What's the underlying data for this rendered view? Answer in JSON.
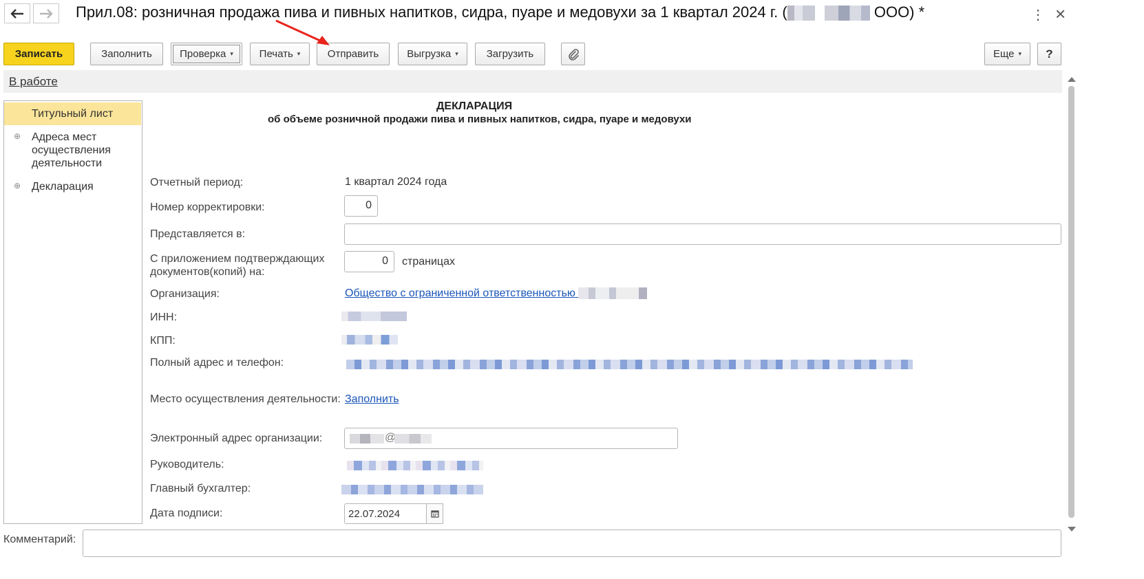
{
  "titlebar": {
    "back_icon": "arrow-left-icon",
    "forward_icon": "arrow-right-icon",
    "title_prefix": "Прил.08: розничная продажа пива и пивных напитков, сидра, пуаре и медовухи за 1 квартал 2024 г. (",
    "title_suffix": " ООО) *",
    "more_icon": "more-vertical-icon",
    "close_icon": "close-icon",
    "more_glyph": "⋮",
    "close_glyph": "×"
  },
  "toolbar": {
    "save": "Записать",
    "fill": "Заполнить",
    "check": "Проверка",
    "print": "Печать",
    "send": "Отправить",
    "export": "Выгрузка",
    "load": "Загрузить",
    "attach_icon": "paperclip-icon",
    "more": "Еще",
    "help": "?",
    "dropdown_glyph": "▾"
  },
  "status": {
    "label": "В работе"
  },
  "sidebar": {
    "items": [
      {
        "label": "Титульный лист",
        "selected": true
      },
      {
        "label": "Адреса мест осуществления деятельности",
        "expandable": true
      },
      {
        "label": "Декларация",
        "expandable": true
      }
    ],
    "expand_glyph": "⊕"
  },
  "form": {
    "heading": "ДЕКЛАРАЦИЯ",
    "subheading": "об объеме розничной продажи пива и пивных напитков, сидра, пуаре и медовухи",
    "period_label": "Отчетный период:",
    "period_value": "1 квартал 2024 года",
    "correction_label": "Номер корректировки:",
    "correction_value": "0",
    "submitted_to_label": "Представляется в:",
    "submitted_to_value": "",
    "attachments_label": "С приложением подтверждающих документов(копий) на:",
    "attachments_value": "0",
    "attachments_unit": "страницах",
    "org_label": "Организация:",
    "org_value": "Общество с ограниченной ответственностью",
    "inn_label": "ИНН:",
    "kpp_label": "КПП:",
    "address_label": "Полный адрес и телефон:",
    "place_label": "Место осуществления деятельности:",
    "place_link": "Заполнить",
    "email_label": "Электронный адрес организации:",
    "email_value_visible": "@",
    "head_label": "Руководитель:",
    "accountant_label": "Главный бухгалтер:",
    "date_label": "Дата подписи:",
    "date_value": "22.07.2024",
    "calendar_icon": "calendar-icon",
    "comment_label": "Комментарий:"
  },
  "colors": {
    "primary_button": "#f7d31e",
    "selected_nav": "#fbe59a",
    "link": "#1a55b8",
    "annotation_arrow": "#e8241c"
  }
}
